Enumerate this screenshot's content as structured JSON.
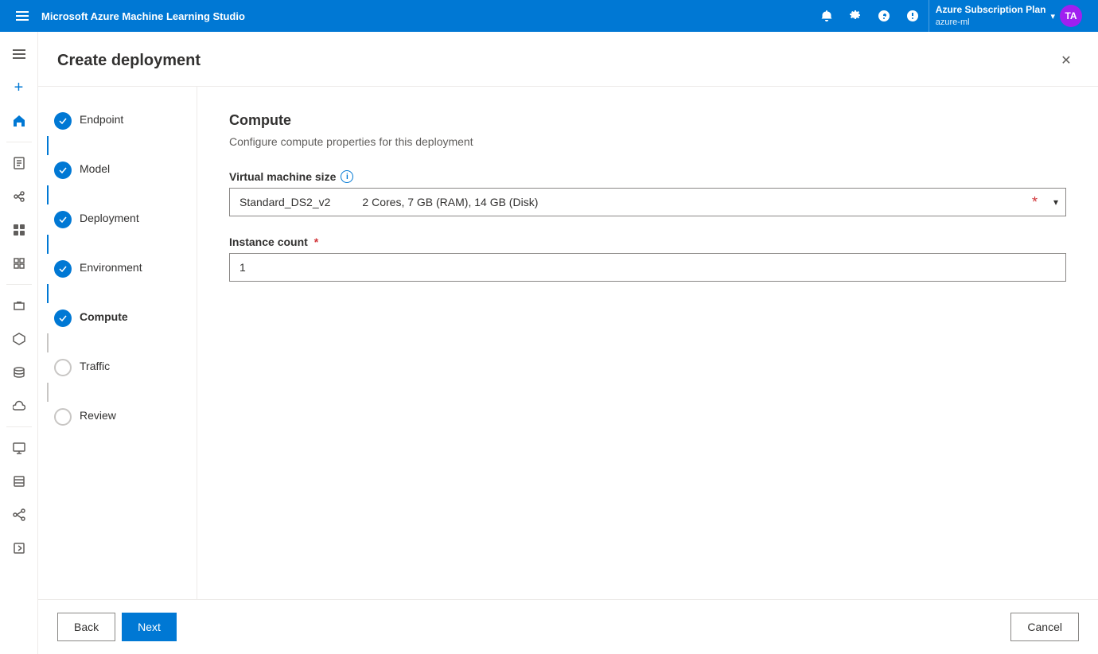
{
  "topbar": {
    "app_name": "Microsoft Azure Machine Learning Studio",
    "account_name": "Azure Subscription Plan",
    "account_sub": "azure-ml",
    "avatar_initials": "TA"
  },
  "dialog": {
    "title": "Create deployment",
    "close_label": "×"
  },
  "steps": [
    {
      "id": "endpoint",
      "label": "Endpoint",
      "state": "completed"
    },
    {
      "id": "model",
      "label": "Model",
      "state": "completed"
    },
    {
      "id": "deployment",
      "label": "Deployment",
      "state": "completed"
    },
    {
      "id": "environment",
      "label": "Environment",
      "state": "completed"
    },
    {
      "id": "compute",
      "label": "Compute",
      "state": "current"
    },
    {
      "id": "traffic",
      "label": "Traffic",
      "state": "pending"
    },
    {
      "id": "review",
      "label": "Review",
      "state": "pending"
    }
  ],
  "compute": {
    "section_title": "Compute",
    "section_desc": "Configure compute properties for this deployment",
    "vm_label": "Virtual machine size",
    "vm_value": "Standard_DS2_v2",
    "vm_desc": "2 Cores, 7 GB (RAM), 14 GB (Disk)",
    "instance_label": "Instance count",
    "instance_required": "*",
    "instance_value": "1"
  },
  "footer": {
    "back_label": "Back",
    "next_label": "Next",
    "cancel_label": "Cancel"
  },
  "sidebar": {
    "icons": [
      "☰",
      "+",
      "⌂",
      "≡",
      "⌘",
      "⊞",
      "⋮⋮",
      "⬜",
      "▦",
      "⬡",
      "⬢",
      "▤",
      "⬡",
      "▦",
      "✏"
    ]
  }
}
